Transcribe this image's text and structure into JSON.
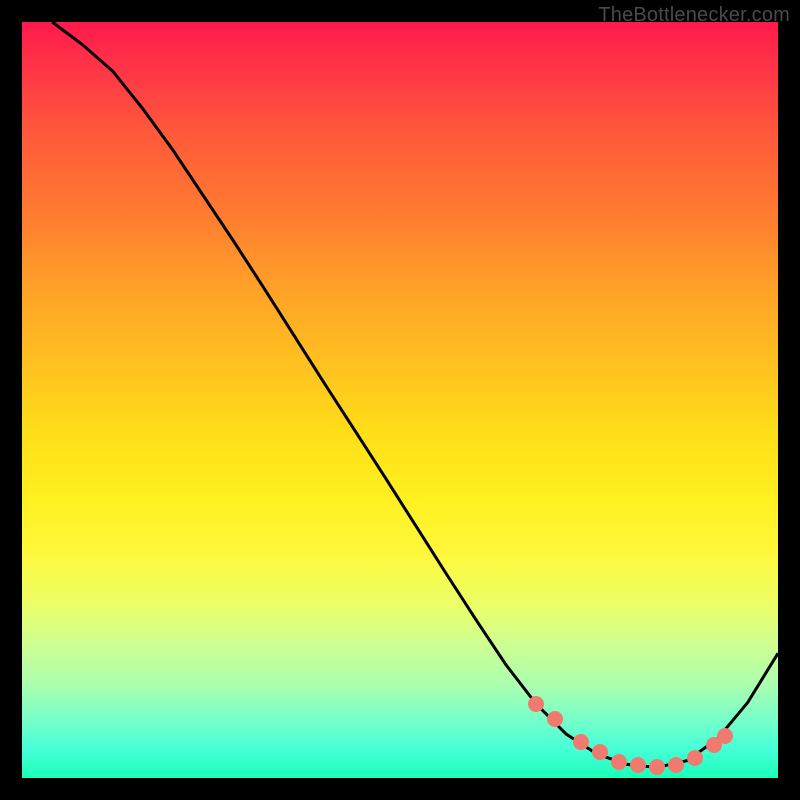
{
  "watermark": "TheBottlenecker.com",
  "chart_data": {
    "type": "line",
    "title": "",
    "xlabel": "",
    "ylabel": "",
    "xlim": [
      0,
      100
    ],
    "ylim": [
      0,
      100
    ],
    "curve": {
      "x": [
        4,
        8,
        12,
        16,
        20,
        24,
        28,
        32,
        36,
        40,
        44,
        48,
        52,
        56,
        60,
        64,
        68,
        72,
        76,
        80,
        84,
        88,
        92,
        96,
        100
      ],
      "y": [
        100,
        97,
        93.5,
        88.5,
        83,
        77,
        71,
        64.8,
        58.5,
        52.2,
        46,
        39.8,
        33.5,
        27.2,
        21,
        15,
        9.8,
        5.8,
        3.2,
        1.8,
        1.4,
        2.3,
        5.2,
        10,
        16.5
      ]
    },
    "markers": {
      "x": [
        68,
        70.5,
        74,
        76.5,
        79,
        81.5,
        84,
        86.5,
        89,
        91.5,
        93
      ],
      "y": [
        9.8,
        7.8,
        4.8,
        3.5,
        2.1,
        1.7,
        1.4,
        1.7,
        2.6,
        4.3,
        5.5
      ]
    },
    "gradient_stops": [
      {
        "pos": 0,
        "color": "#ff1a4a"
      },
      {
        "pos": 50,
        "color": "#ffd018"
      },
      {
        "pos": 100,
        "color": "#1affb8"
      }
    ]
  }
}
